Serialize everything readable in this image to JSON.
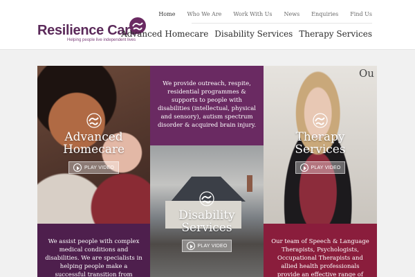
{
  "logo": {
    "name": "Resilience Care",
    "tagline": "Helping people live independent lives",
    "brand_color": "#5b2a5a"
  },
  "top_nav": [
    "Home",
    "Who We Are",
    "Work With Us",
    "News",
    "Enquiries",
    "Find Us"
  ],
  "main_nav": [
    "Advanced Homecare",
    "Disability Services",
    "Therapy Services"
  ],
  "intro_text": "We provide outreach, respite, residential programmes & supports to people with disabilities (intellectual, physical and sensory), autism spectrum disorder & acquired brain injury.",
  "services": {
    "homecare": {
      "title_line1": "Advanced",
      "title_line2": "Homecare",
      "button": "PLAY VIDEO"
    },
    "disability": {
      "title_line1": "Disability",
      "title_line2": "Services",
      "button": "PLAY VIDEO"
    },
    "therapy": {
      "title_line1": "Therapy",
      "title_line2": "Services",
      "button": "PLAY VIDEO"
    }
  },
  "homecare_text": "We assist people with complex medical conditions and disabilities. We are specialists in helping people make a successful transition from hospital and rehab back to",
  "therapy_text": "Our team of Speech & Language Therapists, Psychologists, Occupational Therapists and allied health professionals provide an effective range of assessments and",
  "photo_quote_text": "Ou",
  "colors": {
    "purple": "#6a2a62",
    "dark_purple": "#4e1f4d",
    "crimson": "#8a1d3c"
  }
}
